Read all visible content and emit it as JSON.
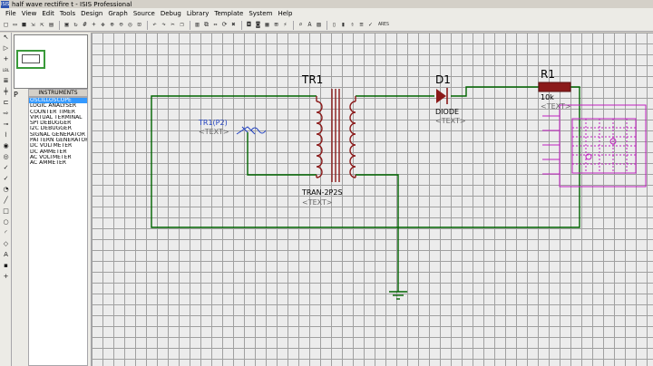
{
  "window": {
    "title": "half wave rectifire t - ISIS Professional",
    "app_icon": "ISIS"
  },
  "menu": [
    "File",
    "View",
    "Edit",
    "Tools",
    "Design",
    "Graph",
    "Source",
    "Debug",
    "Library",
    "Template",
    "System",
    "Help"
  ],
  "toolbar": {
    "icons": [
      "new-file-icon",
      "open-icon",
      "save-icon",
      "import-icon",
      "export-icon",
      "print-icon",
      "area-icon",
      "refresh-icon",
      "grid-icon",
      "origin-icon",
      "pan-icon",
      "zoom-in-icon",
      "zoom-out-icon",
      "zoom-all-icon",
      "zoom-area-icon",
      "undo-icon",
      "redo-icon",
      "cut-icon",
      "copy-icon",
      "paste-icon",
      "block-copy-icon",
      "block-move-icon",
      "block-rotate-icon",
      "block-delete-icon",
      "pick-device-icon",
      "make-device-icon",
      "packaging-icon",
      "decompose-icon",
      "wire-autorouter-icon",
      "search-icon",
      "property-tool-icon",
      "design-explorer-icon",
      "new-sheet-icon",
      "remove-sheet-icon",
      "exit-to-parent-icon",
      "bom-icon",
      "erc-icon",
      "netlist-to-ares-icon"
    ]
  },
  "left_tools": [
    "select-icon",
    "component-icon",
    "junction-icon",
    "wire-label-icon",
    "script-icon",
    "bus-icon",
    "subcircuit-icon",
    "terminal-icon",
    "pin-icon",
    "graph-icon",
    "tape-icon",
    "generator-icon",
    "probe-voltage-icon",
    "probe-current-icon",
    "instrument-icon",
    "line-icon",
    "box-icon",
    "circle-icon",
    "arc-icon",
    "path-icon",
    "text-icon",
    "symbol-icon",
    "marker-icon"
  ],
  "panel": {
    "preview_label": "P",
    "instruments_header": "INSTRUMENTS",
    "instruments": [
      "OSCILLOSCOPE",
      "LOGIC ANALYSER",
      "COUNTER TIMER",
      "VIRTUAL TERMINAL",
      "SPI DEBUGGER",
      "I2C DEBUGGER",
      "SIGNAL GENERATOR",
      "PATTERN GENERATOR",
      "DC VOLTMETER",
      "DC AMMETER",
      "AC VOLTMETER",
      "AC AMMETER"
    ],
    "selected_index": 0
  },
  "schematic": {
    "transformer": {
      "ref": "TR1",
      "type": "TRAN-2P2S",
      "text": "<TEXT>"
    },
    "source": {
      "ref": "TR1(P2)",
      "text": "<TEXT>"
    },
    "diode": {
      "ref": "D1",
      "type": "DIODE",
      "text": "<TEXT>"
    },
    "resistor": {
      "ref": "R1",
      "value": "10k",
      "text": "<TEXT>"
    },
    "colors": {
      "wire": "#006400",
      "component": "#8b1a1a",
      "label": "#000000",
      "placeholder": "#6a6a6a",
      "instrument": "#c020c0",
      "source": "#2040c0"
    }
  }
}
